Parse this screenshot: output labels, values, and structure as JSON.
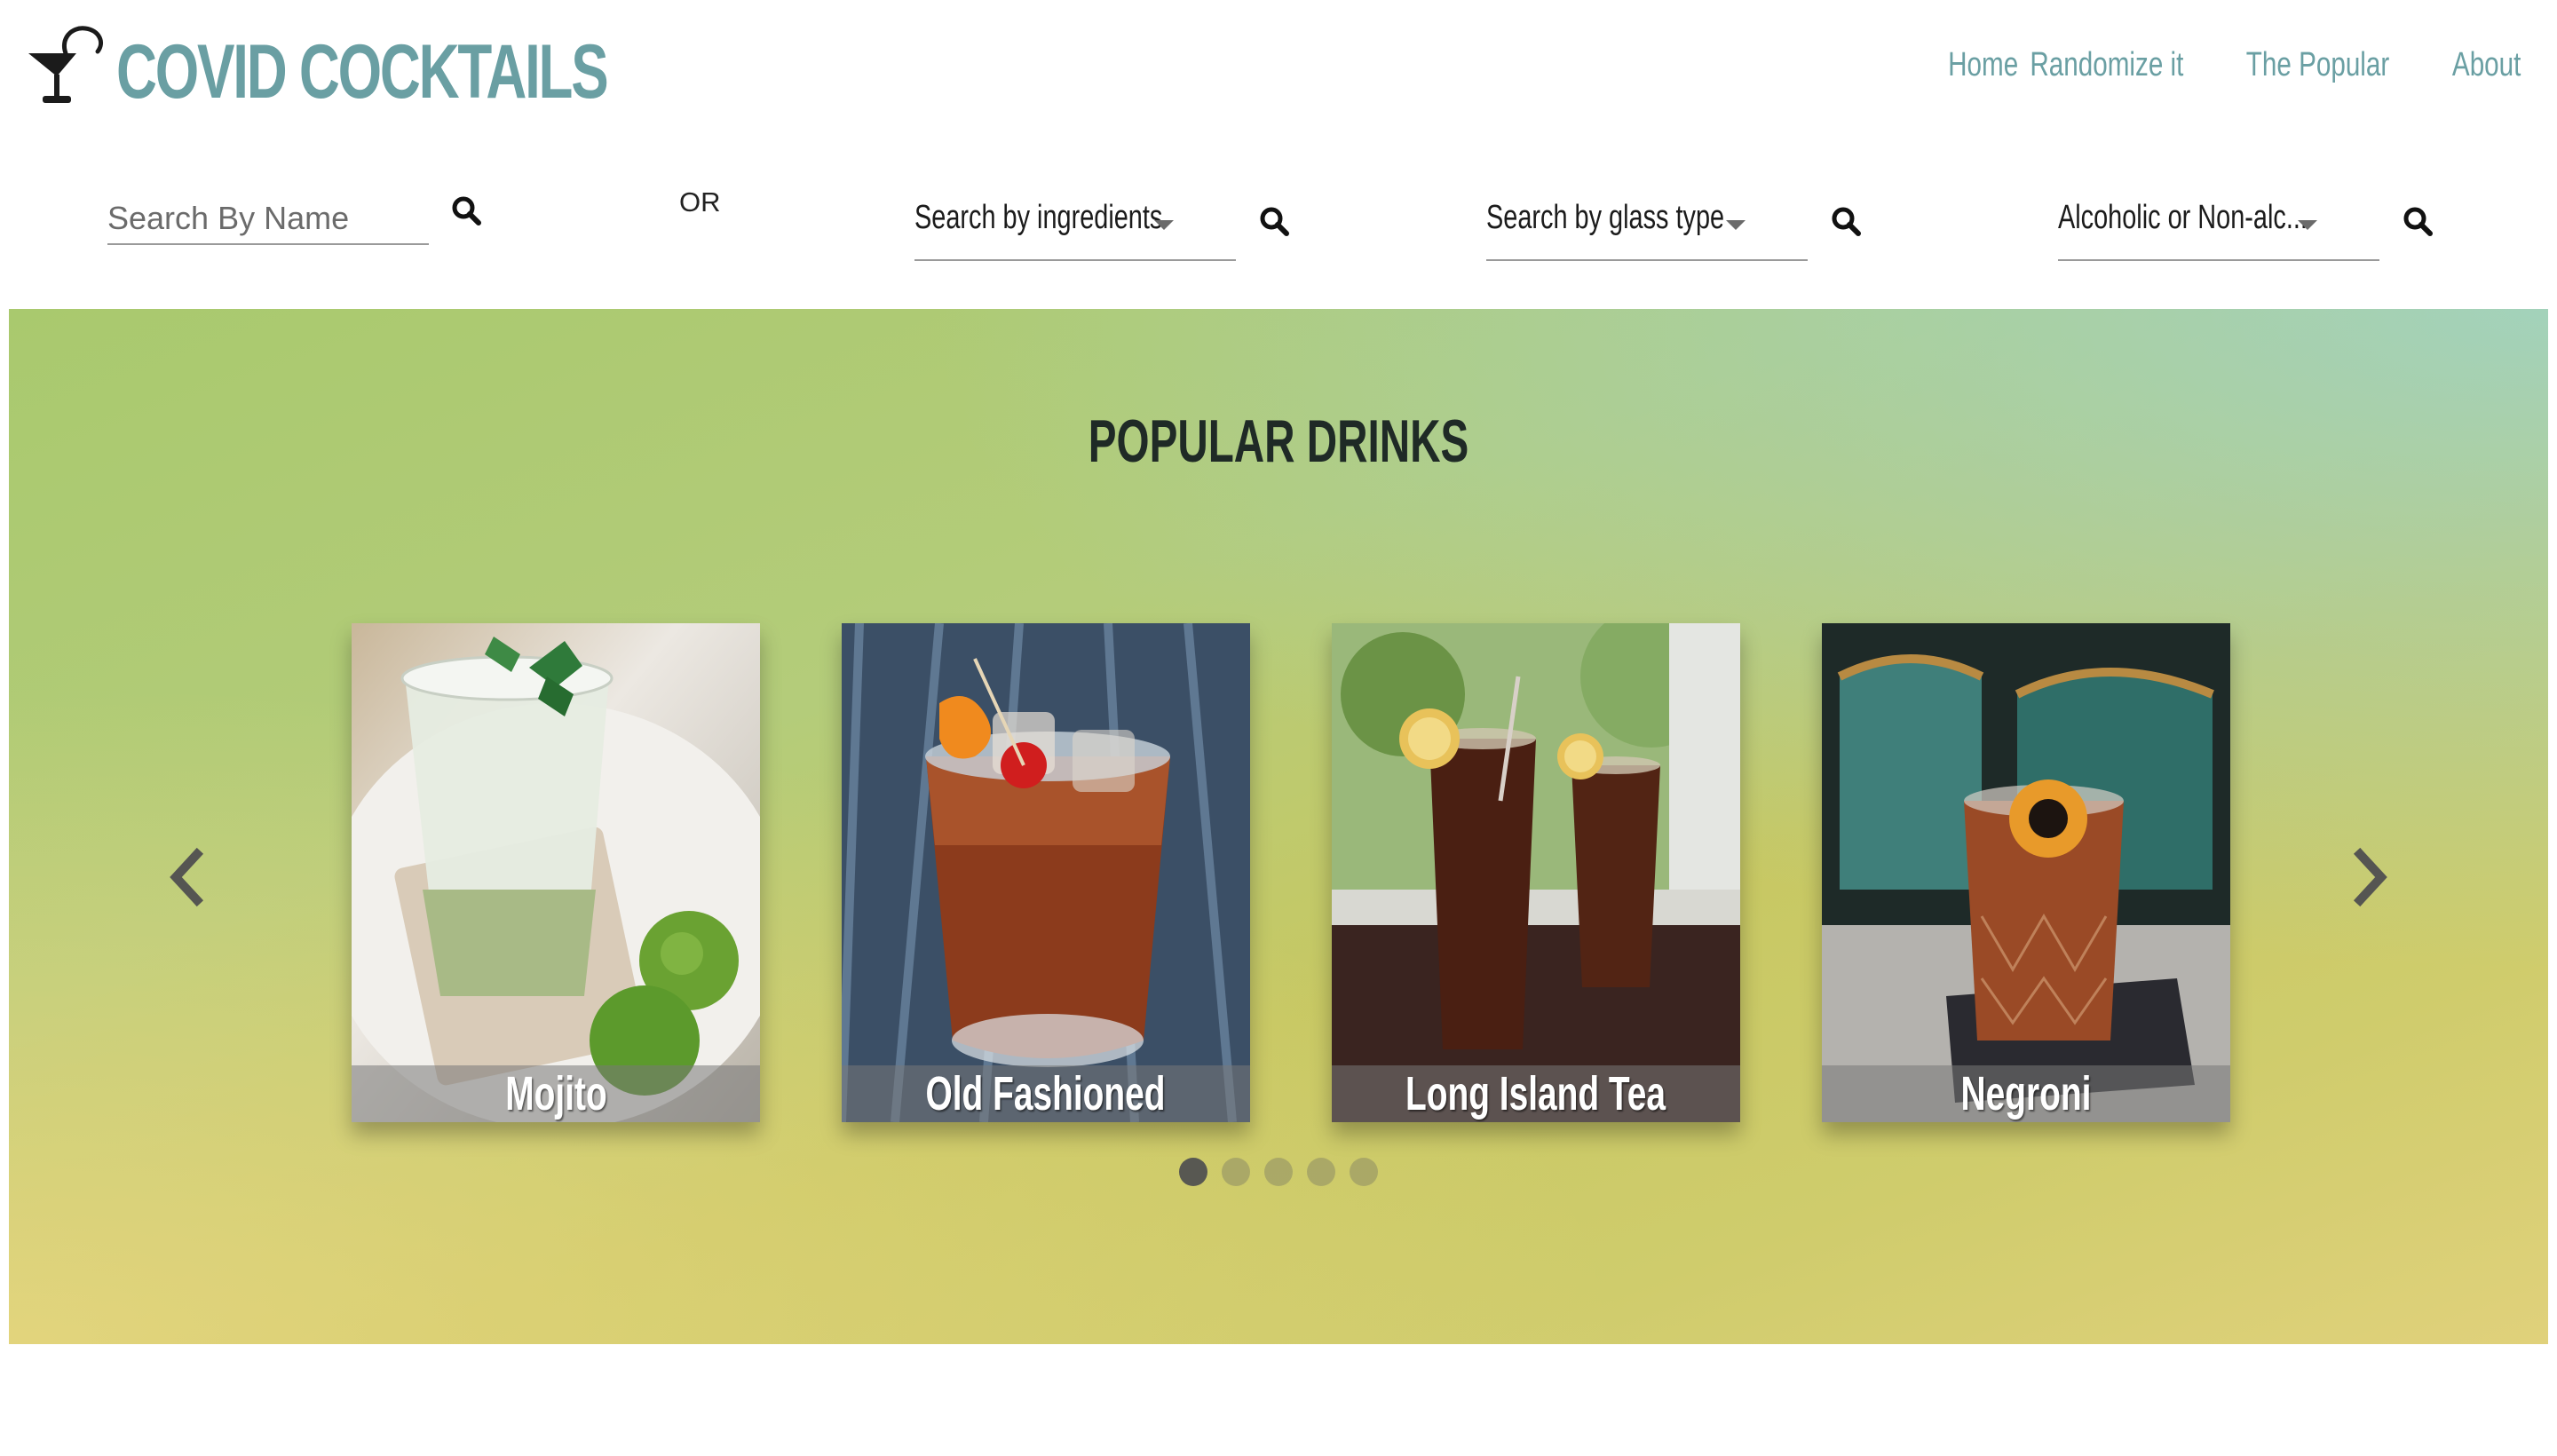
{
  "brand": {
    "name": "COVID COCKTAILS",
    "color": "#6a9fa3"
  },
  "nav": {
    "home": "Home",
    "randomize": "Randomize it",
    "popular": "The Popular",
    "about": "About"
  },
  "search": {
    "name_placeholder": "Search By Name",
    "or_text": "OR",
    "ingredients_label": "Search by ingredients",
    "glass_label": "Search by glass type",
    "alcoholic_label": "Alcoholic or Non-alc..."
  },
  "popular": {
    "title": "POPULAR DRINKS",
    "drinks": [
      {
        "name": "Mojito"
      },
      {
        "name": "Old Fashioned"
      },
      {
        "name": "Long Island Tea"
      },
      {
        "name": "Negroni"
      }
    ],
    "dots": {
      "count": 5,
      "active_index": 0
    }
  }
}
